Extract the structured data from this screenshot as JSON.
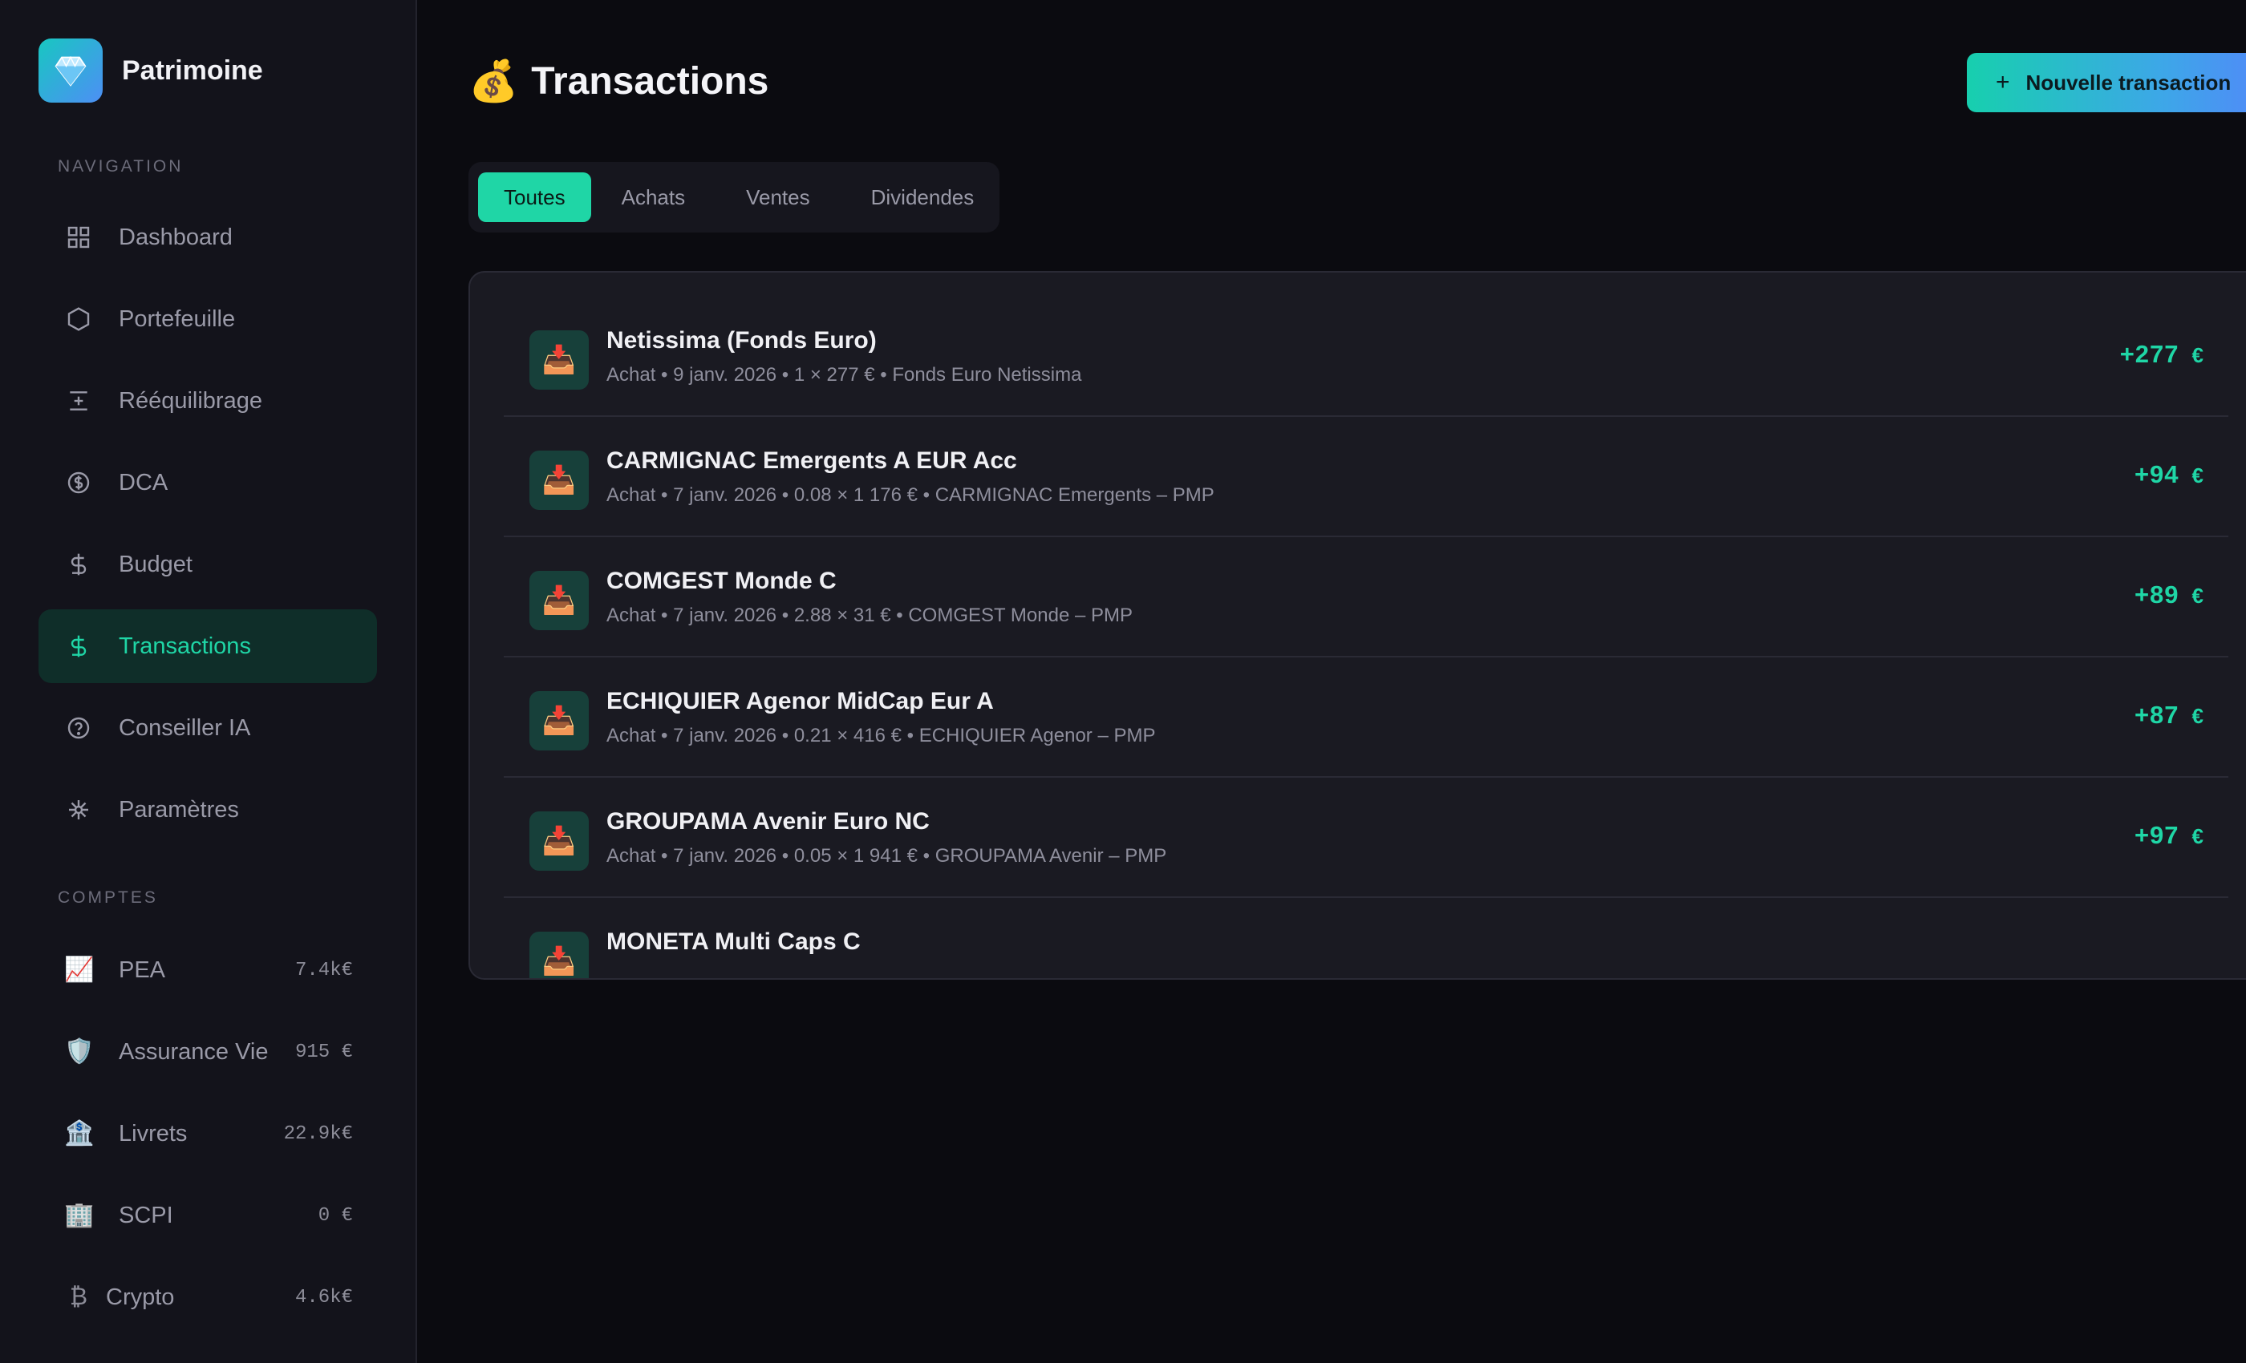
{
  "app": {
    "name": "Patrimoine",
    "logo_icon": "gem-icon"
  },
  "colors": {
    "accent": "#1fd6a6",
    "background": "#0b0b10",
    "sidebar": "#13131b",
    "card": "#1a1a22"
  },
  "sidebar": {
    "navigation_label": "NAVIGATION",
    "nav_items": [
      {
        "label": "Dashboard",
        "icon": "grid-icon"
      },
      {
        "label": "Portefeuille",
        "icon": "hexagon-icon"
      },
      {
        "label": "Rééquilibrage",
        "icon": "balance-icon"
      },
      {
        "label": "DCA",
        "icon": "coin-icon"
      },
      {
        "label": "Budget",
        "icon": "dollar-icon"
      },
      {
        "label": "Transactions",
        "icon": "dollar-icon",
        "active": true
      },
      {
        "label": "Conseiller IA",
        "icon": "help-circle-icon"
      },
      {
        "label": "Paramètres",
        "icon": "settings-icon"
      }
    ],
    "accounts_label": "COMPTES",
    "accounts": [
      {
        "label": "PEA",
        "value": "7.4k€",
        "icon": "chart-up-icon"
      },
      {
        "label": "Assurance Vie",
        "value": "915 €",
        "icon": "shield-icon"
      },
      {
        "label": "Livrets",
        "value": "22.9k€",
        "icon": "bank-icon"
      },
      {
        "label": "SCPI",
        "value": "0 €",
        "icon": "building-icon"
      },
      {
        "label": "Crypto",
        "value": "4.6k€",
        "icon": "bitcoin-icon"
      }
    ]
  },
  "main": {
    "title": "Transactions",
    "title_icon": "money-bag-icon",
    "new_button_label": "Nouvelle transaction",
    "tabs": [
      {
        "label": "Toutes",
        "active": true
      },
      {
        "label": "Achats"
      },
      {
        "label": "Ventes"
      },
      {
        "label": "Dividendes"
      }
    ],
    "transactions": [
      {
        "title": "Netissima (Fonds Euro)",
        "subtitle": "Achat • 9 janv. 2026 • 1 × 277 € • Fonds Euro Netissima",
        "amount": "+277",
        "currency": "€",
        "icon": "inbox-tray-icon"
      },
      {
        "title": "CARMIGNAC Emergents A EUR Acc",
        "subtitle": "Achat • 7 janv. 2026 • 0.08 × 1 176 € • CARMIGNAC Emergents – PMP",
        "amount": "+94",
        "currency": "€",
        "icon": "inbox-tray-icon"
      },
      {
        "title": "COMGEST Monde C",
        "subtitle": "Achat • 7 janv. 2026 • 2.88 × 31 € • COMGEST Monde – PMP",
        "amount": "+89",
        "currency": "€",
        "icon": "inbox-tray-icon"
      },
      {
        "title": "ECHIQUIER Agenor MidCap Eur A",
        "subtitle": "Achat • 7 janv. 2026 • 0.21 × 416 € • ECHIQUIER Agenor – PMP",
        "amount": "+87",
        "currency": "€",
        "icon": "inbox-tray-icon"
      },
      {
        "title": "GROUPAMA Avenir Euro NC",
        "subtitle": "Achat • 7 janv. 2026 • 0.05 × 1 941 € • GROUPAMA Avenir – PMP",
        "amount": "+97",
        "currency": "€",
        "icon": "inbox-tray-icon"
      },
      {
        "title": "MONETA Multi Caps C",
        "subtitle": "",
        "amount": "",
        "currency": "",
        "icon": "inbox-tray-icon"
      }
    ]
  }
}
